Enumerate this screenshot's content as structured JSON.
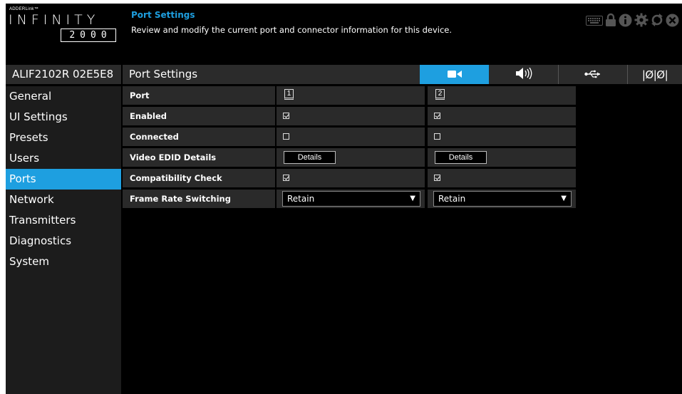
{
  "logo": {
    "small": "ADDERLink™",
    "big": "INFINITY",
    "number": "2000"
  },
  "header": {
    "title": "Port Settings",
    "description": "Review and modify the current port and connector information for this device.",
    "icons": [
      "keyboard-icon",
      "lock-icon",
      "info-icon",
      "gear-icon",
      "refresh-icon",
      "close-icon"
    ]
  },
  "device_name": "ALIF2102R 02E5E8",
  "page_title": "Port Settings",
  "tabs": [
    {
      "name": "video",
      "icon": "video-camera-icon",
      "active": true
    },
    {
      "name": "audio",
      "icon": "speaker-icon",
      "active": false
    },
    {
      "name": "usb",
      "icon": "usb-icon",
      "active": false
    },
    {
      "name": "serial",
      "icon": "serial-icon",
      "label": "|Ø|Ø|",
      "active": false
    }
  ],
  "sidebar": {
    "items": [
      {
        "label": "General"
      },
      {
        "label": "UI Settings"
      },
      {
        "label": "Presets"
      },
      {
        "label": "Users"
      },
      {
        "label": "Ports",
        "active": true
      },
      {
        "label": "Network"
      },
      {
        "label": "Transmitters"
      },
      {
        "label": "Diagnostics"
      },
      {
        "label": "System"
      }
    ]
  },
  "table": {
    "rows": {
      "port": {
        "label": "Port",
        "values": [
          "1",
          "2"
        ]
      },
      "enabled": {
        "label": "Enabled",
        "values": [
          true,
          true
        ]
      },
      "connected": {
        "label": "Connected",
        "values": [
          false,
          false
        ]
      },
      "edid": {
        "label": "Video EDID Details",
        "button": "Details"
      },
      "compat": {
        "label": "Compatibility Check",
        "values": [
          true,
          true
        ]
      },
      "frame_rate": {
        "label": "Frame Rate Switching",
        "values": [
          "Retain",
          "Retain"
        ]
      }
    }
  },
  "colors": {
    "accent": "#1e9fe0",
    "background": "#000000",
    "panel": "#2a2a2a"
  }
}
